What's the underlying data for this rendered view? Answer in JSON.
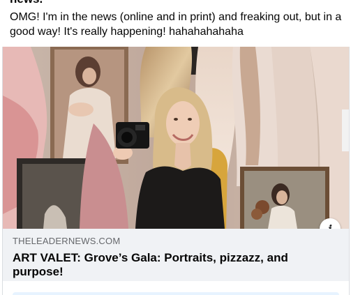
{
  "post": {
    "cut_off_line": "news.",
    "text": "OMG! I'm in the news (online and in print) and freaking out, but in a good way! It's really happening! hahahahahaha"
  },
  "link": {
    "domain": "THELEADERNEWS.COM",
    "headline": "ART VALET: Grove’s Gala: Portraits, pizzazz, and purpose!",
    "info_icon": "info-icon",
    "info_glyph": "i"
  },
  "colors": {
    "meta_background": "#f0f2f5",
    "domain_text": "#65676b",
    "text": "#050505"
  }
}
